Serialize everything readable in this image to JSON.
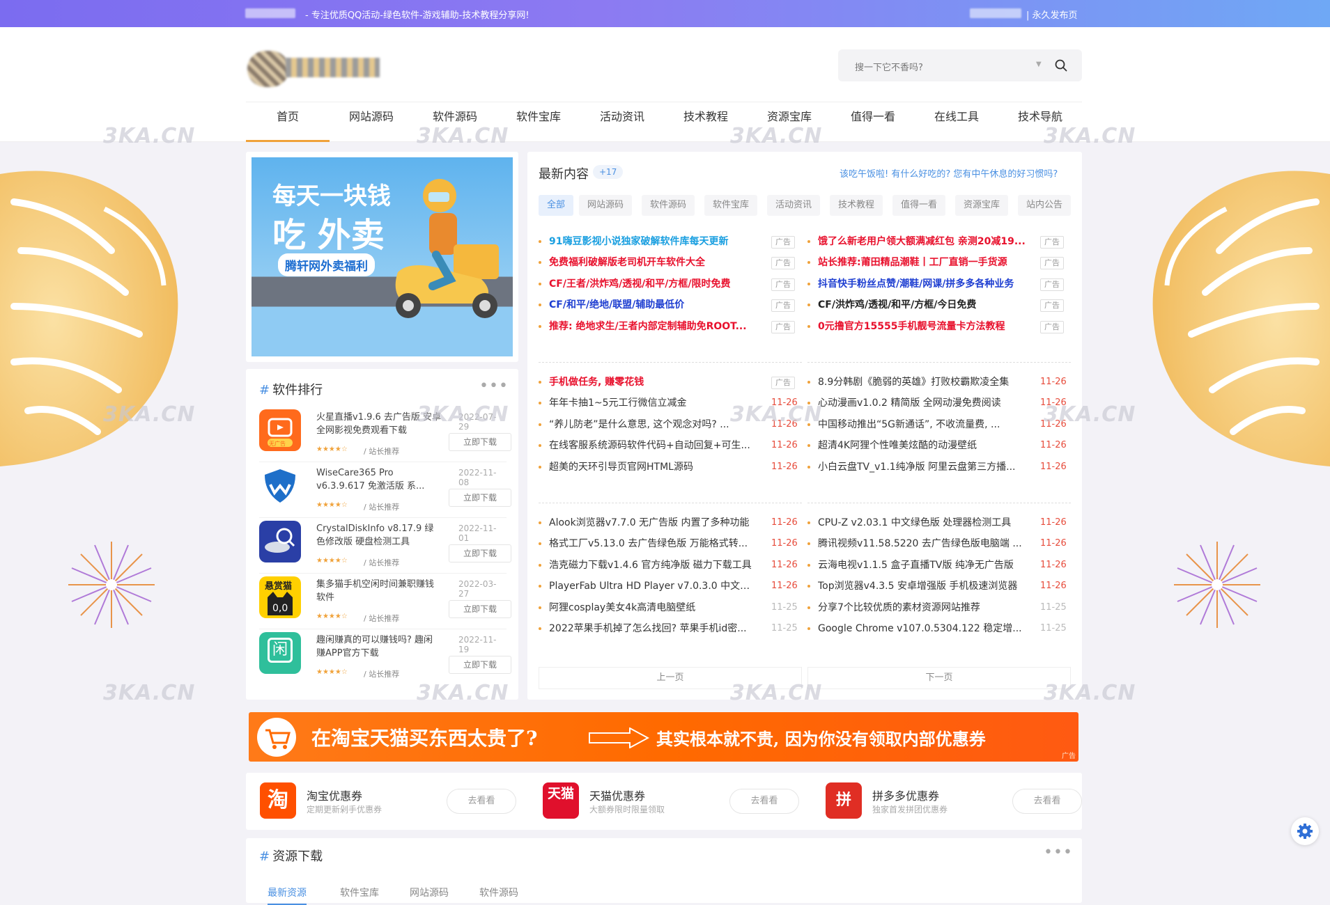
{
  "topbar": {
    "slogan": "- 专注优质QQ活动-绿色软件-游戏辅助-技术教程分享网!",
    "right_link": "| 永久发布页"
  },
  "search": {
    "placeholder": "搜一下它不香吗?"
  },
  "nav": {
    "items": [
      "首页",
      "网站源码",
      "软件源码",
      "软件宝库",
      "活动资讯",
      "技术教程",
      "资源宝库",
      "值得一看",
      "在线工具",
      "技术导航"
    ]
  },
  "watermark": "3KA.CN",
  "banner": {
    "line1": "每天一块钱",
    "line2": "吃 外卖",
    "sub": "腾轩网外卖福利"
  },
  "ranking": {
    "title": "软件排行",
    "more": "•••",
    "items": [
      {
        "title": "火星直播v1.9.6 去广告版 安卓全网影视免费观看下载",
        "date": "2022-07-29",
        "stars": "★★★★☆",
        "tag": "/ 站长推荐",
        "button": "立即下载",
        "icon_label": "无广告",
        "icon": "tv-app-icon"
      },
      {
        "title": "WiseCare365 Pro v6.3.9.617 免激活版 系...",
        "date": "2022-11-08",
        "stars": "★★★★☆",
        "tag": "/ 站长推荐",
        "button": "立即下载",
        "icon": "shield-icon"
      },
      {
        "title": "CrystalDiskInfo v8.17.9 绿色修改版 硬盘检测工具",
        "date": "2022-11-01",
        "stars": "★★★★☆",
        "tag": "/ 站长推荐",
        "button": "立即下载",
        "icon": "disk-search-icon"
      },
      {
        "title": "集多猫手机空闲时间兼职赚钱软件",
        "date": "2022-03-27",
        "stars": "★★★★☆",
        "tag": "/ 站长推荐",
        "button": "立即下载",
        "icon_label": "悬赏猫",
        "icon": "cat-app-icon"
      },
      {
        "title": "趣闲赚真的可以赚钱吗? 趣闲赚APP官方下载",
        "date": "2022-11-19",
        "stars": "★★★★☆",
        "tag": "/ 站长推荐",
        "button": "立即下载",
        "icon_label": "闲",
        "icon": "xian-app-icon"
      }
    ]
  },
  "latest": {
    "title": "最新内容",
    "badge": "+17",
    "notice": "该吃午饭啦! 有什么好吃的? 您有中午休息的好习惯吗?",
    "tabs": [
      "全部",
      "网站源码",
      "软件源码",
      "软件宝库",
      "活动资讯",
      "技术教程",
      "值得一看",
      "资源宝库",
      "站内公告"
    ],
    "ads_left": [
      {
        "text": "91嗨豆影视小说独家破解软件库每天更新",
        "color": "#1a9fe0",
        "label": "广告"
      },
      {
        "text": "免费福利破解版老司机开车软件大全",
        "color": "#e8112d",
        "label": "广告"
      },
      {
        "text": "CF/王者/洪炸鸡/透视/和平/方框/限时免费",
        "color": "#e8112d",
        "label": "广告"
      },
      {
        "text": "CF/和平/绝地/联盟/辅助最低价",
        "color": "#1f3fd1",
        "label": "广告"
      },
      {
        "text": "推荐: 绝地求生/王者内部定制辅助免ROOT...",
        "color": "#e8112d",
        "label": "广告"
      }
    ],
    "ads_right": [
      {
        "text": "饿了么新老用户领大额满减红包 亲测20减19...",
        "color": "#e8112d",
        "label": "广告"
      },
      {
        "text": "站长推荐:莆田精品潮鞋丨工厂直销一手货源",
        "color": "#e8112d",
        "label": "广告"
      },
      {
        "text": "抖音快手粉丝点赞/潮鞋/网课/拼多多各种业务",
        "color": "#1f3fd1",
        "label": "广告"
      },
      {
        "text": "CF/洪炸鸡/透视/和平/方框/今日免费",
        "color": "#222222",
        "label": "广告"
      },
      {
        "text": "0元撸官方15555手机靓号流量卡方法教程",
        "color": "#e8112d",
        "label": "广告"
      }
    ],
    "group1_left": [
      {
        "text": "手机做任务, 赚零花钱",
        "color": "#e8112d",
        "label": "广告"
      },
      {
        "text": "年年卡抽1~5元工行微信立减金",
        "date": "11-26"
      },
      {
        "text": "“养儿防老”是什么意思, 这个观念对吗? ...",
        "date": "11-26"
      },
      {
        "text": "在线客服系统源码软件代码+自动回复+可生...",
        "date": "11-26"
      },
      {
        "text": "超美的天环引导页官网HTML源码",
        "date": "11-26"
      }
    ],
    "group1_right": [
      {
        "text": "8.9分韩剧《脆弱的英雄》打败校霸欺凌全集",
        "date": "11-26"
      },
      {
        "text": "心动漫画v1.0.2 精简版 全网动漫免费阅读",
        "date": "11-26"
      },
      {
        "text": "中国移动推出“5G新通话”, 不收流量费, ...",
        "date": "11-26"
      },
      {
        "text": "超清4K阿狸个性唯美炫酷的动漫壁纸",
        "date": "11-26"
      },
      {
        "text": "小白云盘TV_v1.1纯净版 阿里云盘第三方播...",
        "date": "11-26"
      }
    ],
    "group2_left": [
      {
        "text": "Alook浏览器v7.7.0 无广告版 内置了多种功能",
        "date": "11-26"
      },
      {
        "text": "格式工厂v5.13.0 去广告绿色版 万能格式转...",
        "date": "11-26"
      },
      {
        "text": "浩克磁力下载v1.4.6 官方纯净版 磁力下载工具",
        "date": "11-26"
      },
      {
        "text": "PlayerFab Ultra HD Player v7.0.3.0 中文绿...",
        "date": "11-26"
      },
      {
        "text": "阿狸cosplay美女4k高清电脑壁纸",
        "date": "11-25",
        "old": true
      },
      {
        "text": "2022苹果手机掉了怎么找回? 苹果手机id密...",
        "date": "11-25",
        "old": true
      }
    ],
    "group2_right": [
      {
        "text": "CPU-Z v2.03.1 中文绿色版 处理器检测工具",
        "date": "11-26"
      },
      {
        "text": "腾讯视频v11.58.5220 去广告绿色版电脑端 ...",
        "date": "11-26"
      },
      {
        "text": "云海电视v1.1.5 盒子直播TV版 纯净无广告版",
        "date": "11-26"
      },
      {
        "text": "Top浏览器v4.3.5 安卓增强版 手机极速浏览器",
        "date": "11-26"
      },
      {
        "text": "分享7个比较优质的素材资源网站推荐",
        "date": "11-25",
        "old": true
      },
      {
        "text": "Google Chrome v107.0.5304.122 稳定增...",
        "date": "11-25",
        "old": true
      }
    ],
    "prev": "上一页",
    "next": "下一页"
  },
  "adbar": {
    "text1": "在淘宝天猫买东西太贵了?",
    "text2": "其实根本就不贵, 因为你没有领取内部优惠券",
    "label": "广告"
  },
  "coupons": [
    {
      "name": "淘宝优惠券",
      "sub": "定期更新剁手优惠券",
      "button": "去看看",
      "icon_text": "淘",
      "color": "#ff5000"
    },
    {
      "name": "天猫优惠券",
      "sub": "大额券限时限量领取",
      "button": "去看看",
      "icon_text": "天猫",
      "color": "#e0102c"
    },
    {
      "name": "拼多多优惠券",
      "sub": "独家首发拼团优惠券",
      "button": "去看看",
      "icon_text": "拼",
      "color": "#e02e24"
    }
  ],
  "resources": {
    "title": "资源下载",
    "more": "•••",
    "tabs": [
      "最新资源",
      "软件宝库",
      "网站源码",
      "软件源码"
    ]
  }
}
